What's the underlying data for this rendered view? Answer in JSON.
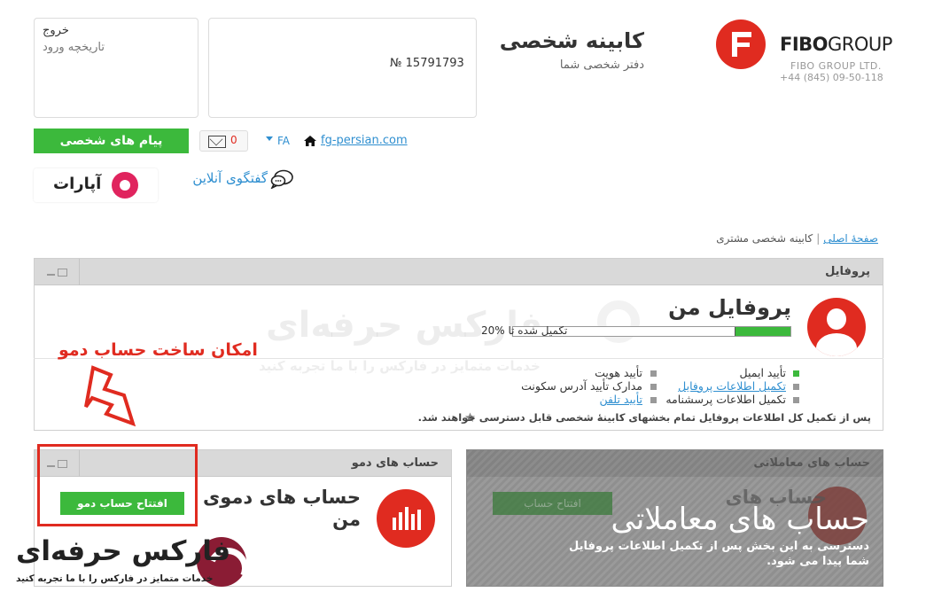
{
  "header": {
    "brand_bold": "FIBO",
    "brand_light": "GROUP",
    "brand_ltd": "FIBO GROUP LTD.",
    "brand_phone": "+44 (845) 09-50-118",
    "cabinet_title": "کابینه شخصی",
    "cabinet_subtitle": "دفتر شخصی شما",
    "account_number": "№ 15791793",
    "logout": "خروج",
    "login_history": "تاریخچه ورود"
  },
  "toolbar": {
    "personal_messages": "پیام های شخصی",
    "mail_count": "0",
    "language": "FA",
    "site_link": "fg-persian.com",
    "online_chat": "گفتگوی آنلاین",
    "aparat": "آپارات"
  },
  "breadcrumb": {
    "home": "صفحهٔ اصلی",
    "separator": "|",
    "current": "کابینه شخصی مشتری"
  },
  "profile": {
    "panel_title": "پروفایل",
    "title": "پروفایل من",
    "progress_label": "تکمیل شده تا",
    "progress_value": "20%",
    "progress_percent": 20,
    "items": [
      {
        "label": "تأیید ایمیل",
        "done": true,
        "link": false
      },
      {
        "label": "تکمیل اطلاعات پروفایل",
        "done": false,
        "link": true
      },
      {
        "label": "تکمیل اطلاعات پرسشنامه",
        "done": false,
        "link": false
      },
      {
        "label": "تأیید هویت",
        "done": false,
        "link": false
      },
      {
        "label": "مدارک تأیید آدرس سکونت",
        "done": false,
        "link": false
      },
      {
        "label": "تأیید تلفن",
        "done": false,
        "link": true
      }
    ],
    "note": "پس از تکمیل کل اطلاعات پروفایل تمام بخشهای کابینهٔ شخصی قابل دسترسی خواهند شد."
  },
  "annotation": {
    "text": "امکان ساخت حساب دمو"
  },
  "demo": {
    "panel_title": "حساب های دمو",
    "title_line1": "حساب های دموی",
    "title_line2": "من",
    "open_button": "افتتاح حساب دمو"
  },
  "trading": {
    "panel_title": "حساب های معاملاتی",
    "title": "حساب های معاملاتی",
    "ghost_title_line1": "حساب های",
    "open_button": "افتتاح حساب",
    "locked_message": "دسترسی به این بخش پس از تکمیل اطلاعات پروفایل شما پیدا می شود."
  },
  "watermark": {
    "main": "فارکس حرفه‌ای",
    "sub": "خدمات متمایز در فارکس را با ما تجربه کنید"
  },
  "colors": {
    "accent_red": "#e02b20",
    "green": "#3cb93c",
    "link_blue": "#2f8fd0"
  }
}
